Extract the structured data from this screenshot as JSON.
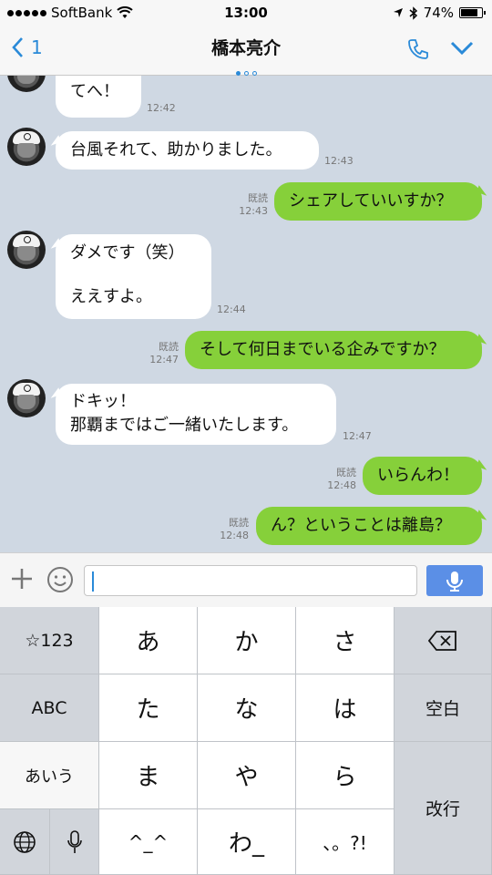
{
  "status_bar": {
    "carrier": "SoftBank",
    "time": "13:00",
    "battery": "74%"
  },
  "nav": {
    "back_count": "1",
    "title": "橋本亮介"
  },
  "messages": [
    {
      "side": "in",
      "text": "てへ！",
      "time": "12:42"
    },
    {
      "side": "in",
      "text": "台風それて、助かりました。",
      "time": "12:43"
    },
    {
      "side": "out",
      "read": "既読",
      "text": "シェアしていいすか？",
      "time": "12:43"
    },
    {
      "side": "in",
      "line1": "ダメです（笑）",
      "line2": "ええすよ。",
      "time": "12:44"
    },
    {
      "side": "out",
      "read": "既読",
      "text": "そして何日までいる企みですか？",
      "time": "12:47"
    },
    {
      "side": "in",
      "line1": "ドキッ！",
      "line2": "那覇まではご一緒いたします。",
      "time": "12:47"
    },
    {
      "side": "out",
      "read": "既読",
      "text": "いらんわ！",
      "time": "12:48"
    },
    {
      "side": "out",
      "read": "既読",
      "text": "ん？ということは離島？",
      "time": "12:48"
    }
  ],
  "input": {
    "value": ""
  },
  "keyboard": {
    "sym": "☆123",
    "abc": "ABC",
    "aiu": "あいう",
    "a": "あ",
    "ka": "か",
    "sa": "さ",
    "ta": "た",
    "na": "な",
    "ha": "は",
    "ma": "ま",
    "ya": "や",
    "ra": "ら",
    "kao": "^_^",
    "wa": "わ_",
    "punct": "、。?!",
    "space": "空白",
    "enter": "改行"
  },
  "colors": {
    "accent": "#2a8ad8",
    "outgoing_bubble": "#86d03a",
    "chat_bg": "#cfd8e3",
    "mic_button": "#5b8fe6"
  },
  "icons": [
    "wifi-icon",
    "location-icon",
    "bluetooth-icon",
    "battery-icon",
    "back-chevron-icon",
    "phone-icon",
    "chevron-down-icon",
    "plus-icon",
    "smiley-icon",
    "microphone-icon",
    "backspace-icon",
    "globe-icon"
  ]
}
